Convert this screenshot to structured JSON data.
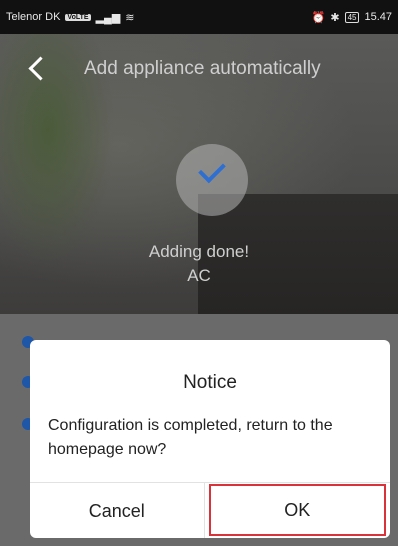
{
  "status_bar": {
    "carrier": "Telenor DK",
    "network_badge": "VoLTE",
    "right_text": "45",
    "time": "15.47"
  },
  "header": {
    "title": "Add appliance automatically",
    "back_icon": "chevron-left-icon"
  },
  "result": {
    "line1": "Adding done!",
    "line2": "AC",
    "icon": "check-icon"
  },
  "dialog": {
    "title": "Notice",
    "message": "Configuration is completed, return to the homepage now?",
    "cancel_label": "Cancel",
    "ok_label": "OK"
  },
  "colors": {
    "accent": "#2f6fd1",
    "highlight": "#d9323b"
  }
}
